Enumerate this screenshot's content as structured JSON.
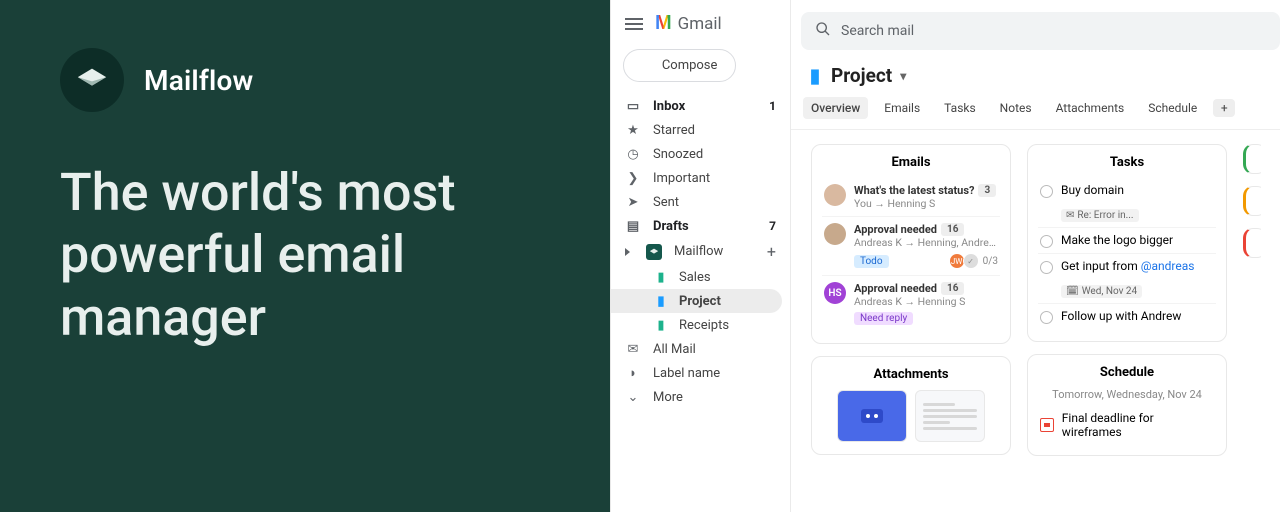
{
  "hero": {
    "name": "Mailflow",
    "tagline": "The world's most powerful email manager"
  },
  "gmail": {
    "label": "Gmail",
    "compose": "Compose",
    "search_placeholder": "Search mail",
    "nav": {
      "inbox": {
        "label": "Inbox",
        "count": "1"
      },
      "starred": {
        "label": "Starred"
      },
      "snoozed": {
        "label": "Snoozed"
      },
      "important": {
        "label": "Important"
      },
      "sent": {
        "label": "Sent"
      },
      "drafts": {
        "label": "Drafts",
        "count": "7"
      },
      "mailflow": {
        "label": "Mailflow"
      },
      "allmail": {
        "label": "All Mail"
      },
      "labelname": {
        "label": "Label name"
      },
      "more": {
        "label": "More"
      }
    },
    "folders": {
      "sales": "Sales",
      "project": "Project",
      "receipts": "Receipts"
    }
  },
  "page": {
    "title": "Project",
    "tabs": {
      "overview": "Overview",
      "emails": "Emails",
      "tasks": "Tasks",
      "notes": "Notes",
      "attachments": "Attachments",
      "schedule": "Schedule"
    }
  },
  "board": {
    "emails": {
      "title": "Emails",
      "items": [
        {
          "subject": "What's the latest status?",
          "count": "3",
          "from": "You → Henning S"
        },
        {
          "subject": "Approval needed",
          "count": "16",
          "from": "Andreas K → Henning, Andreas, jami",
          "tag": "Todo",
          "progress": "0/3"
        },
        {
          "subject": "Approval needed",
          "count": "16",
          "from": "Andreas K → Henning S",
          "tag": "Need reply"
        }
      ]
    },
    "tasks": {
      "title": "Tasks",
      "items": [
        {
          "label": "Buy domain",
          "chip": "Re: Error in..."
        },
        {
          "label": "Make the logo bigger"
        },
        {
          "label_pre": "Get input from ",
          "mention": "@andreas",
          "chip": "Wed, Nov 24"
        },
        {
          "label": "Follow up with Andrew"
        }
      ]
    },
    "attachments": {
      "title": "Attachments"
    },
    "schedule": {
      "title": "Schedule",
      "subtitle": "Tomorrow, Wednesday, Nov 24",
      "items": [
        {
          "label": "Final deadline for wireframes"
        }
      ]
    }
  }
}
